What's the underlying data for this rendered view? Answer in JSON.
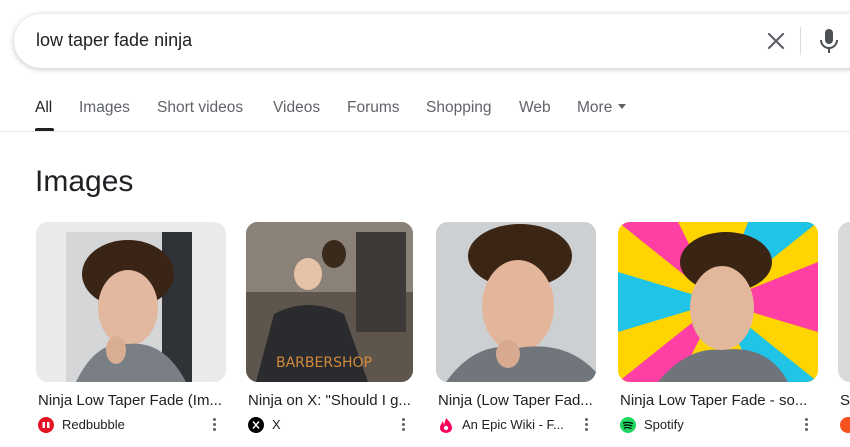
{
  "search": {
    "query": "low taper fade ninja"
  },
  "tabs": [
    {
      "label": "All",
      "active": true
    },
    {
      "label": "Images"
    },
    {
      "label": "Short videos"
    },
    {
      "label": "Videos"
    },
    {
      "label": "Forums"
    },
    {
      "label": "Shopping"
    },
    {
      "label": "Web"
    },
    {
      "label": "More"
    }
  ],
  "images_section": {
    "title": "Images",
    "results": [
      {
        "title": "Ninja Low Taper Fade (Im...",
        "source": "Redbubble",
        "source_icon": "redbubble-icon",
        "source_color": "#e41321"
      },
      {
        "title": "Ninja on X: \"Should I g...",
        "source": "X",
        "source_icon": "x-icon",
        "source_color": "#000000"
      },
      {
        "title": "Ninja (Low Taper Fad...",
        "source": "An Epic Wiki - F...",
        "source_icon": "fandom-icon",
        "source_color": "#fa005a"
      },
      {
        "title": "Ninja Low Taper Fade - so...",
        "source": "Spotify",
        "source_icon": "spotify-icon",
        "source_color": "#1ed760"
      },
      {
        "title": "S",
        "source": "",
        "source_icon": "partial-source-icon",
        "source_color": "#f4511e"
      }
    ]
  },
  "colors": {
    "text": "#202124",
    "secondary": "#5f6368",
    "divider": "#e8eaed"
  }
}
